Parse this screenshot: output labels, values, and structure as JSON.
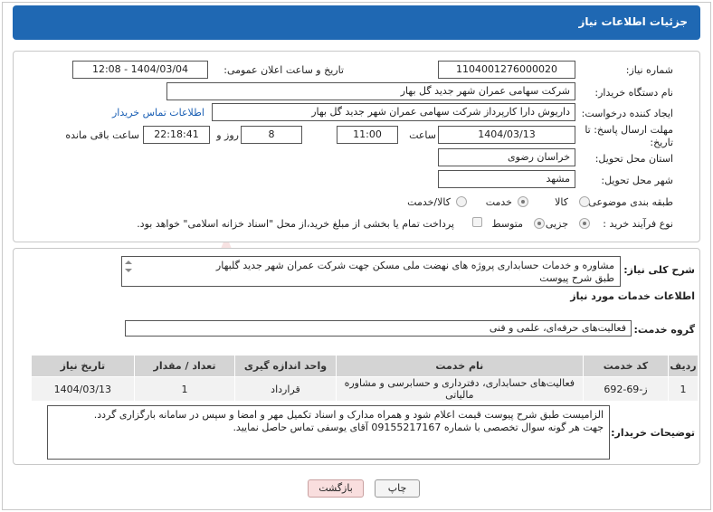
{
  "header": {
    "title": "جزئیات اطلاعات نیاز"
  },
  "form": {
    "need_number_label": "شماره نیاز:",
    "need_number": "1104001276000020",
    "announce_label": "تاریخ و ساعت اعلان عمومی:",
    "announce_value": "1404/03/04 - 12:08",
    "buyer_org_label": "نام دستگاه خریدار:",
    "buyer_org": "شرکت سهامی عمران شهر جدید گل بهار",
    "creator_label": "ایجاد کننده درخواست:",
    "creator": "داریوش دارا کارپرداز شرکت سهامی عمران شهر جدید گل بهار",
    "contact_link": "اطلاعات تماس خریدار",
    "deadline_label_1": "مهلت ارسال پاسخ: تا",
    "deadline_label_2": "تاریخ:",
    "deadline_date": "1404/03/13",
    "time_label": "ساعت",
    "deadline_time": "11:00",
    "days_value": "8",
    "days_label": "روز و",
    "remaining_time": "22:18:41",
    "remaining_label": "ساعت باقی مانده",
    "province_label": "استان محل تحویل:",
    "province": "خراسان رضوی",
    "city_label": "شهر محل تحویل:",
    "city": "مشهد",
    "category_label": "طبقه بندی موضوعی:",
    "category_options": [
      "کالا",
      "خدمت",
      "کالا/خدمت"
    ],
    "category_selected": "خدمت",
    "process_label": "نوع فرآیند خرید :",
    "process_options": [
      "جزیی",
      "متوسط"
    ],
    "process_selected": "جزیی",
    "payment_note": "پرداخت تمام یا بخشی از مبلغ خرید،از محل \"اسناد خزانه اسلامی\" خواهد بود."
  },
  "details": {
    "summary_label": "شرح کلی نیاز:",
    "summary_line1": "مشاوره و خدمات حسابداری پروژه های نهضت ملی مسکن جهت شرکت عمران شهر جدید گلبهار",
    "summary_line2": "طبق شرح پیوست",
    "services_heading": "اطلاعات خدمات مورد نیاز",
    "service_group_label": "گروه خدمت:",
    "service_group": "فعالیت‌های حرفه‌ای، علمی و فنی",
    "table": {
      "headers": [
        "ردیف",
        "کد خدمت",
        "نام خدمت",
        "واحد اندازه گیری",
        "تعداد / مقدار",
        "تاریخ نیاز"
      ],
      "rows": [
        [
          "1",
          "ز-69-692",
          "فعالیت‌های حسابداری، دفترداری و حسابرسی و مشاوره مالیاتی",
          "قرارداد",
          "1",
          "1404/03/13"
        ]
      ]
    },
    "buyer_notes_label": "توضیحات خریدار:",
    "buyer_notes_line1": "الزامیست طبق شرح پیوست قیمت اعلام شود و  همراه مدارک و اسناد تکمیل مهر و امضا و سپس در سامانه بارگزاری گردد.",
    "buyer_notes_line2": "جهت هر گونه سوال تخصصی با شماره 09155217167 آقای یوسفی تماس حاصل نمایید."
  },
  "buttons": {
    "print": "چاپ",
    "back": "بازگشت"
  },
  "colors": {
    "title_bar": "#1f68b3",
    "link": "#1a5fb4",
    "back_button": "#f9dede"
  }
}
